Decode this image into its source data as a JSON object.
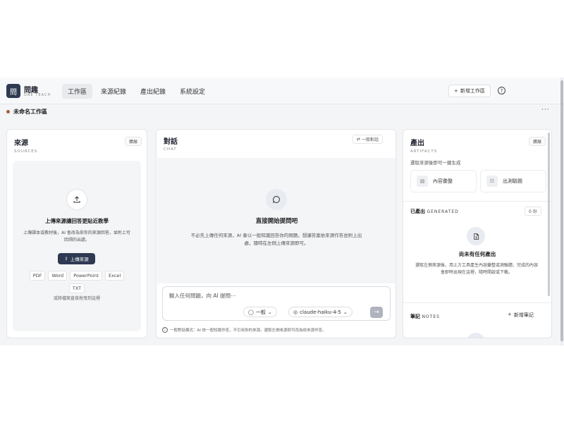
{
  "brand": {
    "logo_glyph": "問",
    "name": "問趣",
    "subtitle": "ONE TEACH"
  },
  "nav": [
    {
      "label": "工作區",
      "active": true
    },
    {
      "label": "來源紀錄",
      "active": false
    },
    {
      "label": "產出紀錄",
      "active": false
    },
    {
      "label": "系統設定",
      "active": false
    }
  ],
  "header": {
    "new_workspace": "新增工作區",
    "help_icon": "?"
  },
  "workspace": {
    "name": "未命名工作區",
    "more": "···",
    "dot_color": "#a6623a"
  },
  "sources": {
    "title": "來源",
    "subtitle": "SOURCES",
    "chip": "擴展",
    "upload_title": "上傳來源讓回答更貼近教學",
    "upload_desc": "上傳課本或教材後，AI 會改為依你的來源回答，並附上可回溯的出處。",
    "upload_button": "上傳來源",
    "file_types": [
      "PDF",
      "Word",
      "PowerPoint",
      "Excel",
      "TXT"
    ],
    "drag_hint": "或將檔案直接拖曳到這裡"
  },
  "chat": {
    "title": "對話",
    "subtitle": "CHAT",
    "mode_chip": "一般對話",
    "empty_title": "直接開始提問吧",
    "empty_desc": "不必先上傳任何來源，AI 會以一般知識回答你的問題。想讓答案依來源作答並附上出處，隨時在左側上傳來源即可。",
    "input_placeholder": "輸入任何問題，向 AI 提問⋯",
    "mode_select": "一般",
    "model_select": "claude-haiku-4-5",
    "send_icon": "→",
    "footer_note": "一般對話模式：AI 依一般知識作答，不引用你的來源。選取左側來源即可改為依來源作答。"
  },
  "artifacts": {
    "title": "產出",
    "subtitle": "ARTIFACTS",
    "chip": "擴展",
    "hint": "選取來源後即可一鍵生成",
    "tools": [
      {
        "label": "內容彙整",
        "icon": "document-icon"
      },
      {
        "label": "出測驗題",
        "icon": "checklist-icon"
      }
    ],
    "generated_label": "已產出",
    "generated_label_en": "GENERATED",
    "generated_count": "0 份",
    "empty_title": "尚未有任何產出",
    "empty_desc": "選取左側來源後，用上方工具產生內容彙整或測驗題，完成的內容會即時出現在這裡，隨時開啟或下載。",
    "notes_label": "筆記",
    "notes_label_en": "NOTES",
    "new_note": "新增筆記"
  },
  "colors": {
    "accent": "#2f3a52",
    "background": "#f4f5f7"
  }
}
